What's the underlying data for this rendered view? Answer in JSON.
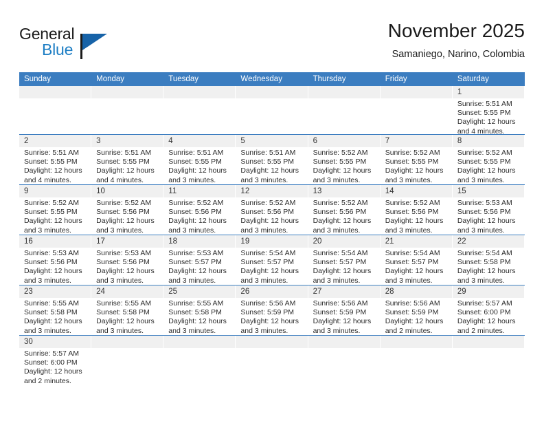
{
  "brand": {
    "word1": "General",
    "word2": "Blue",
    "logo_icon": "blue-triangle-flag-icon"
  },
  "header": {
    "month_title": "November 2025",
    "location": "Samaniego, Narino, Colombia"
  },
  "colors": {
    "header_blue": "#3b7dc0",
    "brand_blue": "#1d7ec4",
    "day_band_gray": "#f0f0f0",
    "cell_white": "#ffffff",
    "text_dark": "#1a1a1a"
  },
  "calendar": {
    "day_headers": [
      "Sunday",
      "Monday",
      "Tuesday",
      "Wednesday",
      "Thursday",
      "Friday",
      "Saturday"
    ],
    "weeks": [
      [
        {
          "day": "",
          "empty": true
        },
        {
          "day": "",
          "empty": true
        },
        {
          "day": "",
          "empty": true
        },
        {
          "day": "",
          "empty": true
        },
        {
          "day": "",
          "empty": true
        },
        {
          "day": "",
          "empty": true
        },
        {
          "day": "1",
          "sunrise": "Sunrise: 5:51 AM",
          "sunset": "Sunset: 5:55 PM",
          "daylight1": "Daylight: 12 hours",
          "daylight2": "and 4 minutes."
        }
      ],
      [
        {
          "day": "2",
          "sunrise": "Sunrise: 5:51 AM",
          "sunset": "Sunset: 5:55 PM",
          "daylight1": "Daylight: 12 hours",
          "daylight2": "and 4 minutes."
        },
        {
          "day": "3",
          "sunrise": "Sunrise: 5:51 AM",
          "sunset": "Sunset: 5:55 PM",
          "daylight1": "Daylight: 12 hours",
          "daylight2": "and 4 minutes."
        },
        {
          "day": "4",
          "sunrise": "Sunrise: 5:51 AM",
          "sunset": "Sunset: 5:55 PM",
          "daylight1": "Daylight: 12 hours",
          "daylight2": "and 3 minutes."
        },
        {
          "day": "5",
          "sunrise": "Sunrise: 5:51 AM",
          "sunset": "Sunset: 5:55 PM",
          "daylight1": "Daylight: 12 hours",
          "daylight2": "and 3 minutes."
        },
        {
          "day": "6",
          "sunrise": "Sunrise: 5:52 AM",
          "sunset": "Sunset: 5:55 PM",
          "daylight1": "Daylight: 12 hours",
          "daylight2": "and 3 minutes."
        },
        {
          "day": "7",
          "sunrise": "Sunrise: 5:52 AM",
          "sunset": "Sunset: 5:55 PM",
          "daylight1": "Daylight: 12 hours",
          "daylight2": "and 3 minutes."
        },
        {
          "day": "8",
          "sunrise": "Sunrise: 5:52 AM",
          "sunset": "Sunset: 5:55 PM",
          "daylight1": "Daylight: 12 hours",
          "daylight2": "and 3 minutes."
        }
      ],
      [
        {
          "day": "9",
          "sunrise": "Sunrise: 5:52 AM",
          "sunset": "Sunset: 5:55 PM",
          "daylight1": "Daylight: 12 hours",
          "daylight2": "and 3 minutes."
        },
        {
          "day": "10",
          "sunrise": "Sunrise: 5:52 AM",
          "sunset": "Sunset: 5:56 PM",
          "daylight1": "Daylight: 12 hours",
          "daylight2": "and 3 minutes."
        },
        {
          "day": "11",
          "sunrise": "Sunrise: 5:52 AM",
          "sunset": "Sunset: 5:56 PM",
          "daylight1": "Daylight: 12 hours",
          "daylight2": "and 3 minutes."
        },
        {
          "day": "12",
          "sunrise": "Sunrise: 5:52 AM",
          "sunset": "Sunset: 5:56 PM",
          "daylight1": "Daylight: 12 hours",
          "daylight2": "and 3 minutes."
        },
        {
          "day": "13",
          "sunrise": "Sunrise: 5:52 AM",
          "sunset": "Sunset: 5:56 PM",
          "daylight1": "Daylight: 12 hours",
          "daylight2": "and 3 minutes."
        },
        {
          "day": "14",
          "sunrise": "Sunrise: 5:52 AM",
          "sunset": "Sunset: 5:56 PM",
          "daylight1": "Daylight: 12 hours",
          "daylight2": "and 3 minutes."
        },
        {
          "day": "15",
          "sunrise": "Sunrise: 5:53 AM",
          "sunset": "Sunset: 5:56 PM",
          "daylight1": "Daylight: 12 hours",
          "daylight2": "and 3 minutes."
        }
      ],
      [
        {
          "day": "16",
          "sunrise": "Sunrise: 5:53 AM",
          "sunset": "Sunset: 5:56 PM",
          "daylight1": "Daylight: 12 hours",
          "daylight2": "and 3 minutes."
        },
        {
          "day": "17",
          "sunrise": "Sunrise: 5:53 AM",
          "sunset": "Sunset: 5:56 PM",
          "daylight1": "Daylight: 12 hours",
          "daylight2": "and 3 minutes."
        },
        {
          "day": "18",
          "sunrise": "Sunrise: 5:53 AM",
          "sunset": "Sunset: 5:57 PM",
          "daylight1": "Daylight: 12 hours",
          "daylight2": "and 3 minutes."
        },
        {
          "day": "19",
          "sunrise": "Sunrise: 5:54 AM",
          "sunset": "Sunset: 5:57 PM",
          "daylight1": "Daylight: 12 hours",
          "daylight2": "and 3 minutes."
        },
        {
          "day": "20",
          "sunrise": "Sunrise: 5:54 AM",
          "sunset": "Sunset: 5:57 PM",
          "daylight1": "Daylight: 12 hours",
          "daylight2": "and 3 minutes."
        },
        {
          "day": "21",
          "sunrise": "Sunrise: 5:54 AM",
          "sunset": "Sunset: 5:57 PM",
          "daylight1": "Daylight: 12 hours",
          "daylight2": "and 3 minutes."
        },
        {
          "day": "22",
          "sunrise": "Sunrise: 5:54 AM",
          "sunset": "Sunset: 5:58 PM",
          "daylight1": "Daylight: 12 hours",
          "daylight2": "and 3 minutes."
        }
      ],
      [
        {
          "day": "23",
          "sunrise": "Sunrise: 5:55 AM",
          "sunset": "Sunset: 5:58 PM",
          "daylight1": "Daylight: 12 hours",
          "daylight2": "and 3 minutes."
        },
        {
          "day": "24",
          "sunrise": "Sunrise: 5:55 AM",
          "sunset": "Sunset: 5:58 PM",
          "daylight1": "Daylight: 12 hours",
          "daylight2": "and 3 minutes."
        },
        {
          "day": "25",
          "sunrise": "Sunrise: 5:55 AM",
          "sunset": "Sunset: 5:58 PM",
          "daylight1": "Daylight: 12 hours",
          "daylight2": "and 3 minutes."
        },
        {
          "day": "26",
          "sunrise": "Sunrise: 5:56 AM",
          "sunset": "Sunset: 5:59 PM",
          "daylight1": "Daylight: 12 hours",
          "daylight2": "and 3 minutes."
        },
        {
          "day": "27",
          "sunrise": "Sunrise: 5:56 AM",
          "sunset": "Sunset: 5:59 PM",
          "daylight1": "Daylight: 12 hours",
          "daylight2": "and 3 minutes."
        },
        {
          "day": "28",
          "sunrise": "Sunrise: 5:56 AM",
          "sunset": "Sunset: 5:59 PM",
          "daylight1": "Daylight: 12 hours",
          "daylight2": "and 2 minutes."
        },
        {
          "day": "29",
          "sunrise": "Sunrise: 5:57 AM",
          "sunset": "Sunset: 6:00 PM",
          "daylight1": "Daylight: 12 hours",
          "daylight2": "and 2 minutes."
        }
      ],
      [
        {
          "day": "30",
          "sunrise": "Sunrise: 5:57 AM",
          "sunset": "Sunset: 6:00 PM",
          "daylight1": "Daylight: 12 hours",
          "daylight2": "and 2 minutes."
        },
        {
          "day": "",
          "empty": true
        },
        {
          "day": "",
          "empty": true
        },
        {
          "day": "",
          "empty": true
        },
        {
          "day": "",
          "empty": true
        },
        {
          "day": "",
          "empty": true
        },
        {
          "day": "",
          "empty": true
        }
      ]
    ]
  }
}
